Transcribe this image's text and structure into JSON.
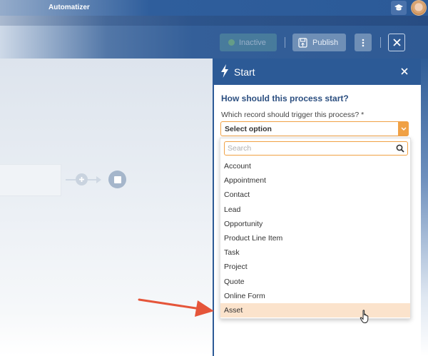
{
  "app": {
    "title": "Automatizer"
  },
  "toolbar": {
    "inactive_label": "Inactive",
    "publish_label": "Publish"
  },
  "panel": {
    "title": "Start",
    "question": "How should this process start?",
    "field_label": "Which record should trigger this process? *",
    "select_value": "Select option",
    "search_placeholder": "Search",
    "options": [
      "Account",
      "Appointment",
      "Contact",
      "Lead",
      "Opportunity",
      "Product Line Item",
      "Task",
      "Project",
      "Quote",
      "Online Form",
      "Asset"
    ],
    "highlighted_option": "Asset"
  },
  "colors": {
    "header_blue": "#2c5a96",
    "accent_orange": "#f0a145",
    "highlight": "#fbe3cc",
    "annotation_arrow": "#e5553a"
  },
  "icons": [
    "graduation-cap-icon",
    "avatar",
    "toggle-icon",
    "publish-icon",
    "more-vertical-icon",
    "close-icon",
    "bolt-icon",
    "chevron-down-icon",
    "search-icon",
    "plus-icon",
    "stop-icon",
    "hand-cursor-icon",
    "annotation-arrow"
  ]
}
